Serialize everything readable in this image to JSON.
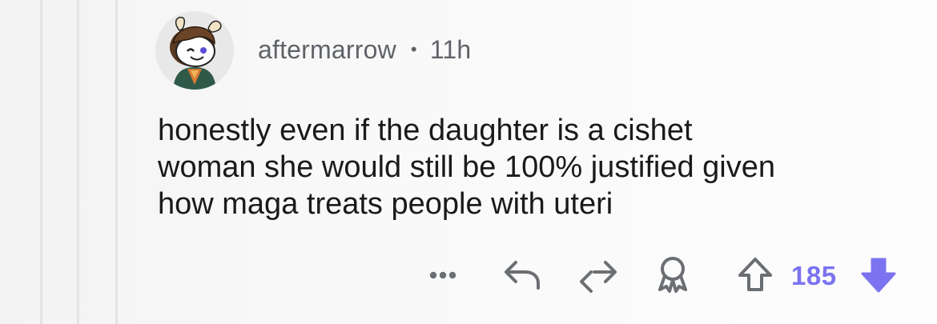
{
  "comment": {
    "author": "aftermarrow",
    "separator": "•",
    "age": "11h",
    "body_lines": [
      "honestly even if the daughter is a cishet",
      "woman she would still be 100% justified given",
      "how maga treats people with uteri"
    ],
    "score": "185",
    "vote_state": "downvoted"
  },
  "icons": {
    "more": "more-dots-icon",
    "reply": "reply-arrow-icon",
    "share": "share-icon",
    "award": "award-icon",
    "upvote": "upvote-arrow-icon",
    "downvote": "downvote-arrow-icon"
  },
  "colors": {
    "downvote_active": "#7b73f0",
    "text": "#1a1a1b",
    "meta_text": "#5f6368",
    "icon_gray": "#6b6e72"
  }
}
